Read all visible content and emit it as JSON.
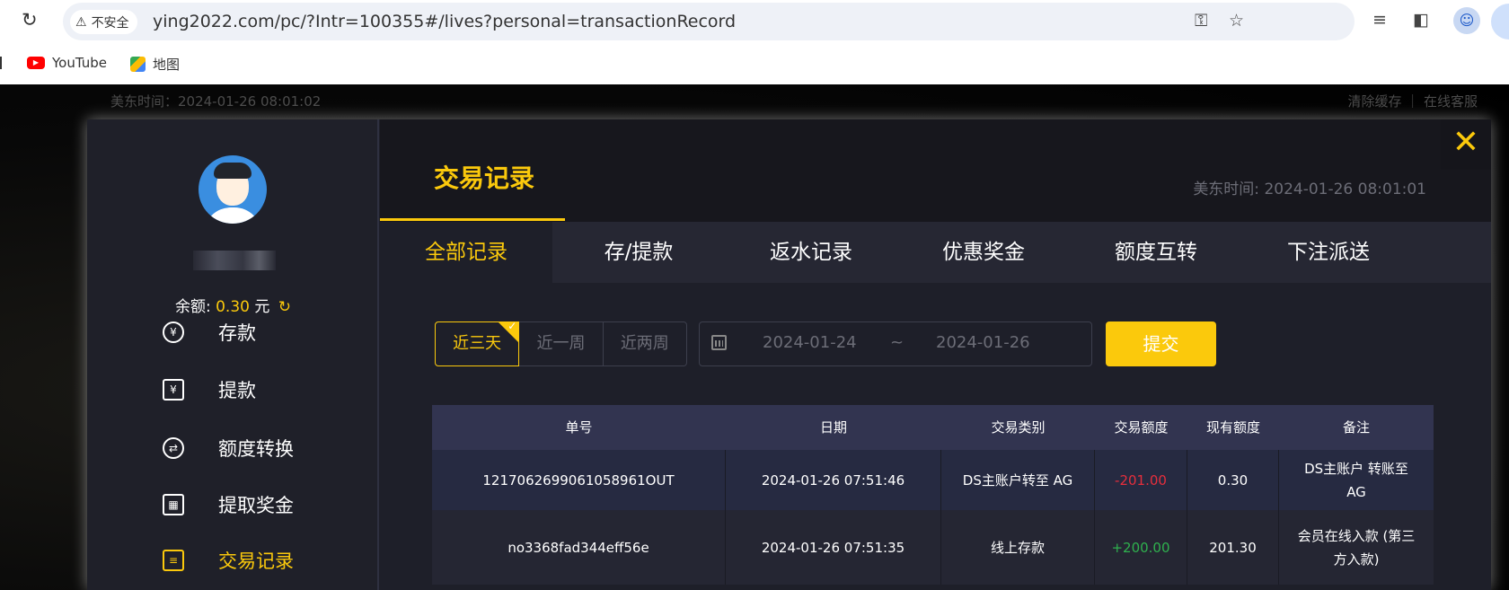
{
  "browser": {
    "security_label": "不安全",
    "url": "ying2022.com/pc/?Intr=100355#/lives?personal=transactionRecord",
    "bookmarks": [
      {
        "label": "YouTube",
        "icon": "youtube-icon"
      },
      {
        "label": "地图",
        "icon": "maps-icon"
      }
    ]
  },
  "site_header": {
    "time_text": "美东时间：2024-01-26 08:01:02",
    "links_text": "清除缓存 ｜ 在线客服"
  },
  "sidebar": {
    "balance_label": "余额:",
    "balance_amount": "0.30",
    "balance_unit": "元",
    "menu": [
      {
        "label": "存款",
        "icon": "yen-coin-icon"
      },
      {
        "label": "提款",
        "icon": "withdraw-ticket-icon"
      },
      {
        "label": "额度转换",
        "icon": "transfer-coin-icon"
      },
      {
        "label": "提取奖金",
        "icon": "gift-icon"
      },
      {
        "label": "交易记录",
        "icon": "record-icon",
        "active": true
      }
    ]
  },
  "main": {
    "title": "交易记录",
    "et_time": "美东时间:  2024-01-26 08:01:01",
    "tabs": [
      {
        "label": "全部记录",
        "active": true
      },
      {
        "label": "存/提款"
      },
      {
        "label": "返水记录"
      },
      {
        "label": "优惠奖金"
      },
      {
        "label": "额度互转"
      },
      {
        "label": "下注派送"
      }
    ],
    "filters": {
      "ranges": [
        "近三天",
        "近一周",
        "近两周"
      ],
      "active_range": "近三天",
      "date_start": "2024-01-24",
      "date_separator": "~",
      "date_end": "2024-01-26",
      "submit_label": "提交"
    },
    "table": {
      "headers": [
        "单号",
        "日期",
        "交易类别",
        "交易额度",
        "现有额度",
        "备注"
      ],
      "rows": [
        {
          "id": "1217062699061058961OUT",
          "date": "2024-01-26 07:51:46",
          "type": "DS主账户转至 AG",
          "amount": "-201.00",
          "balance": "0.30",
          "note": "DS主账户 转账至 AG"
        },
        {
          "id": "no3368fad344eff56e",
          "date": "2024-01-26 07:51:35",
          "type": "线上存款",
          "amount": "+200.00",
          "balance": "201.30",
          "note": "会员在线入款 (第三方入款)"
        }
      ]
    }
  },
  "colors": {
    "accent": "#fbc90c",
    "negative": "#e62e3c",
    "positive": "#2fb14e",
    "panel": "#1e1f29"
  }
}
